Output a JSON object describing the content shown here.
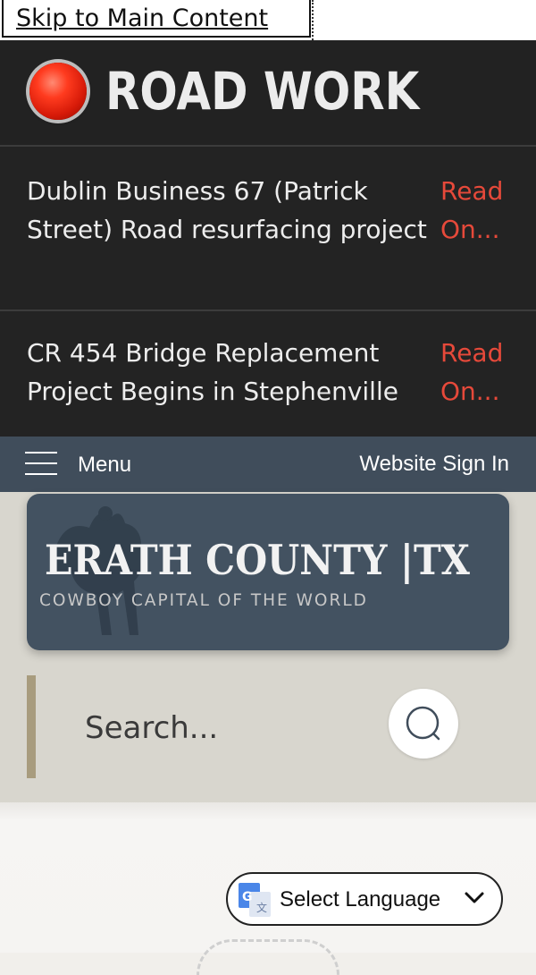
{
  "skip_link": {
    "label": "Skip to Main Content"
  },
  "alert_header": {
    "title": "ROAD WORK",
    "dot_color": "#e52a12"
  },
  "alerts": [
    {
      "text": "Dublin Business 67 (Patrick Street) Road resurfacing project",
      "link_label": "Read On..."
    },
    {
      "text": "CR 454 Bridge Replacement Project Begins in Stephenville",
      "link_label": "Read On..."
    }
  ],
  "nav": {
    "menu_label": "Menu",
    "sign_in_label": "Website Sign In"
  },
  "logo": {
    "title": "ERATH COUNTY |TX",
    "tagline": "COWBOY CAPITAL OF THE WORLD"
  },
  "search": {
    "placeholder": "Search..."
  },
  "language": {
    "label": "Select Language"
  },
  "colors": {
    "alert_bg": "#232323",
    "link_accent": "#e6493a",
    "nav_bg": "#404d5b",
    "logo_bg": "#435261",
    "search_accent": "#a89c7e"
  }
}
